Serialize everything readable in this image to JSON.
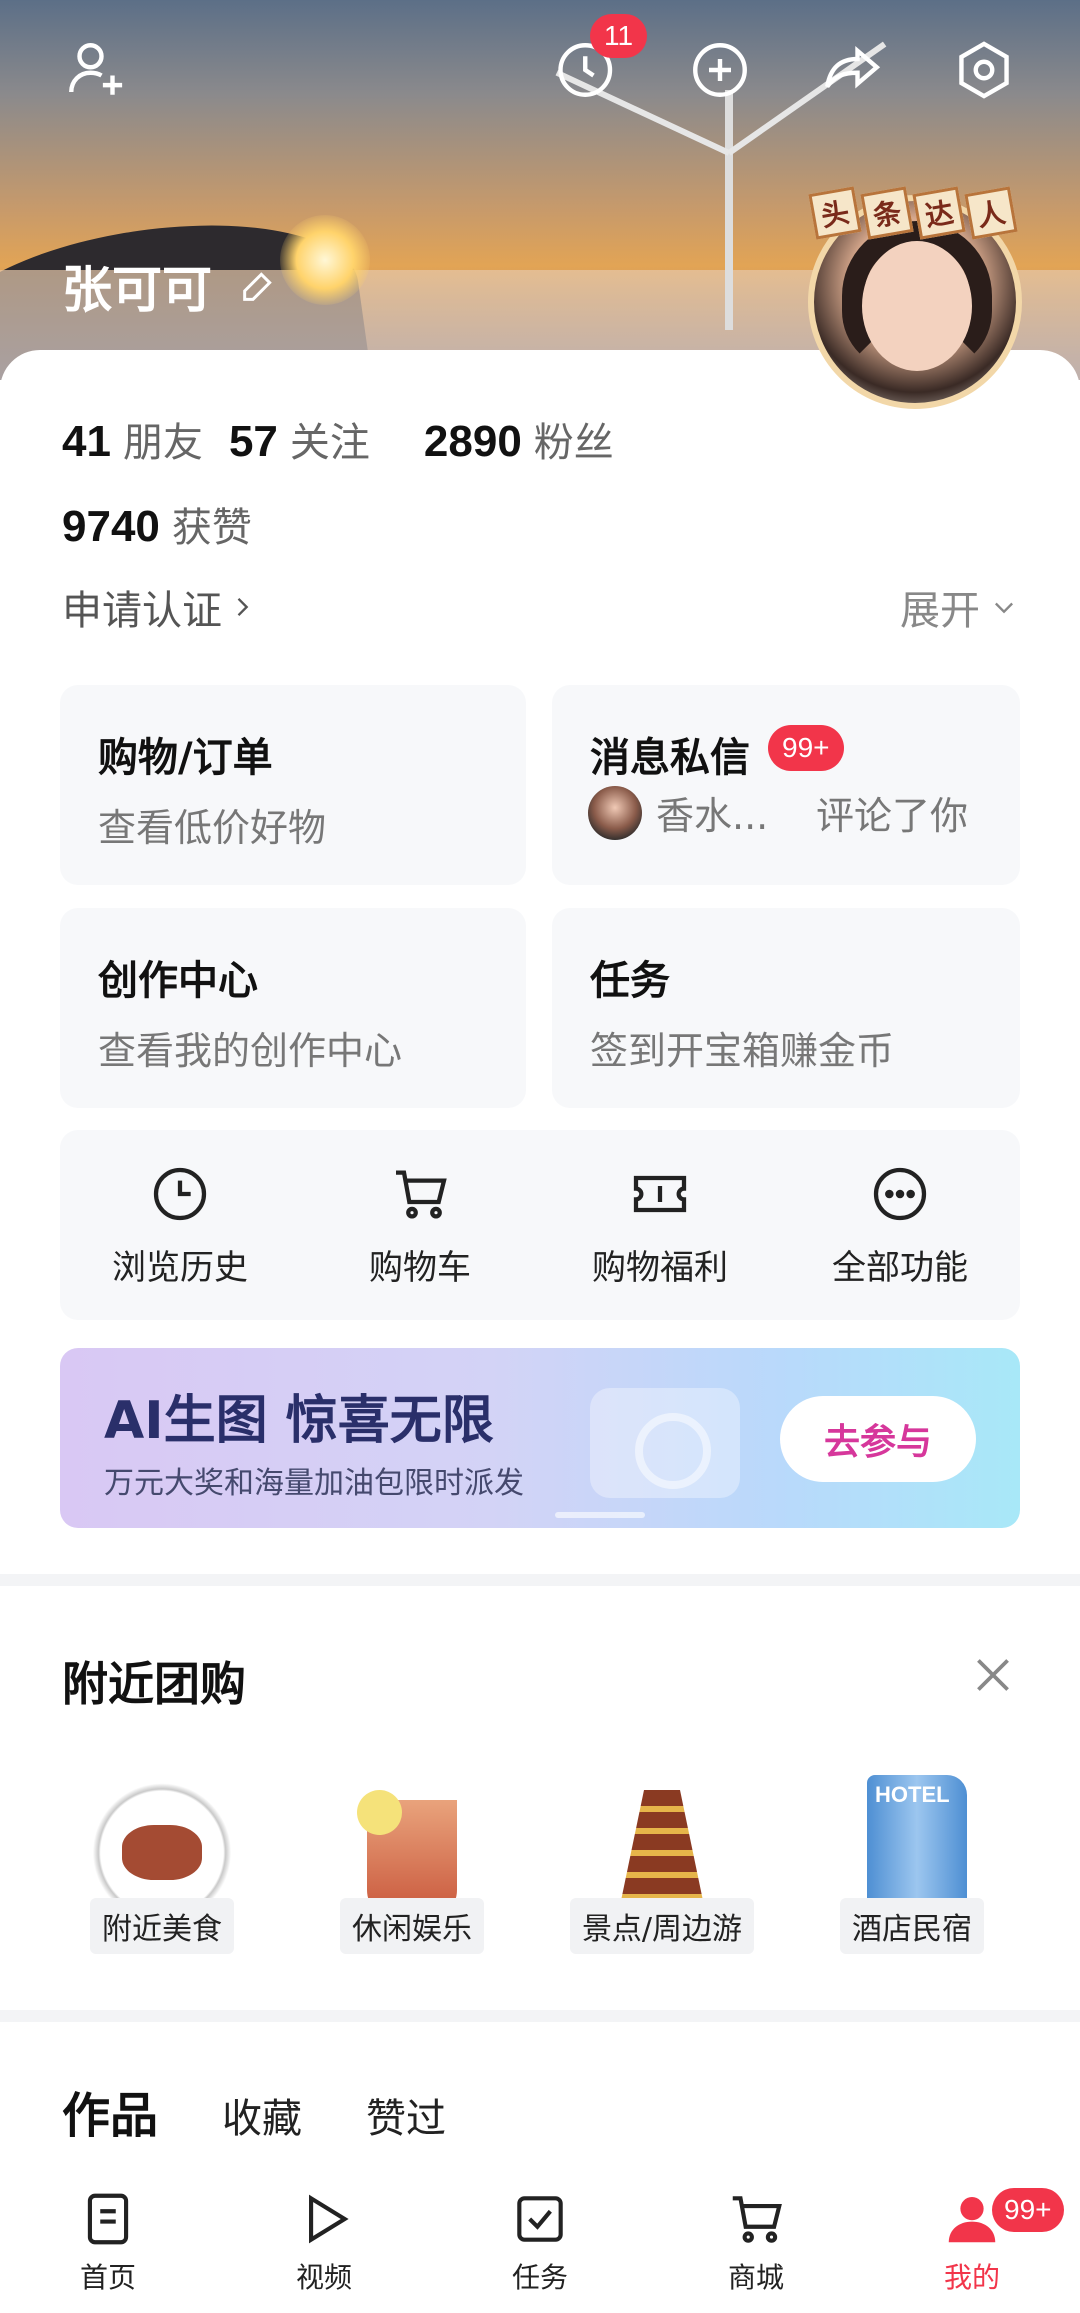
{
  "header": {
    "user_name": "张可可",
    "visitor_badge": "11",
    "avatar_tag": [
      "头",
      "条",
      "达",
      "人"
    ]
  },
  "stats": {
    "friends_count": "41",
    "friends_label": "朋友",
    "following_count": "57",
    "following_label": "关注",
    "followers_count": "2890",
    "followers_label": "粉丝",
    "likes_count": "9740",
    "likes_label": "获赞"
  },
  "profile": {
    "apply_verify": "申请认证",
    "expand": "展开"
  },
  "cards": {
    "shopping": {
      "title": "购物/订单",
      "sub": "查看低价好物"
    },
    "messages": {
      "title": "消息私信",
      "badge": "99+",
      "sender": "香水...",
      "action": "评论了你"
    },
    "creator": {
      "title": "创作中心",
      "sub": "查看我的创作中心"
    },
    "tasks": {
      "title": "任务",
      "sub": "签到开宝箱赚金币"
    }
  },
  "quick_actions": [
    {
      "label": "浏览历史",
      "icon": "clock-icon"
    },
    {
      "label": "购物车",
      "icon": "cart-icon"
    },
    {
      "label": "购物福利",
      "icon": "ticket-icon"
    },
    {
      "label": "全部功能",
      "icon": "more-icon"
    }
  ],
  "promo": {
    "title": "AI生图 惊喜无限",
    "subtitle": "万元大奖和海量加油包限时派发",
    "button": "去参与"
  },
  "nearby": {
    "title": "附近团购",
    "categories": [
      "附近美食",
      "休闲娱乐",
      "景点/周边游",
      "酒店民宿"
    ],
    "hotel_sign": "HOTEL"
  },
  "content_tabs": [
    "作品",
    "收藏",
    "赞过"
  ],
  "bottom_nav": {
    "items": [
      "首页",
      "视频",
      "任务",
      "商城",
      "我的"
    ],
    "me_badge": "99+"
  },
  "colors": {
    "accent": "#f2354a",
    "promo_button_text": "#d6379b"
  }
}
